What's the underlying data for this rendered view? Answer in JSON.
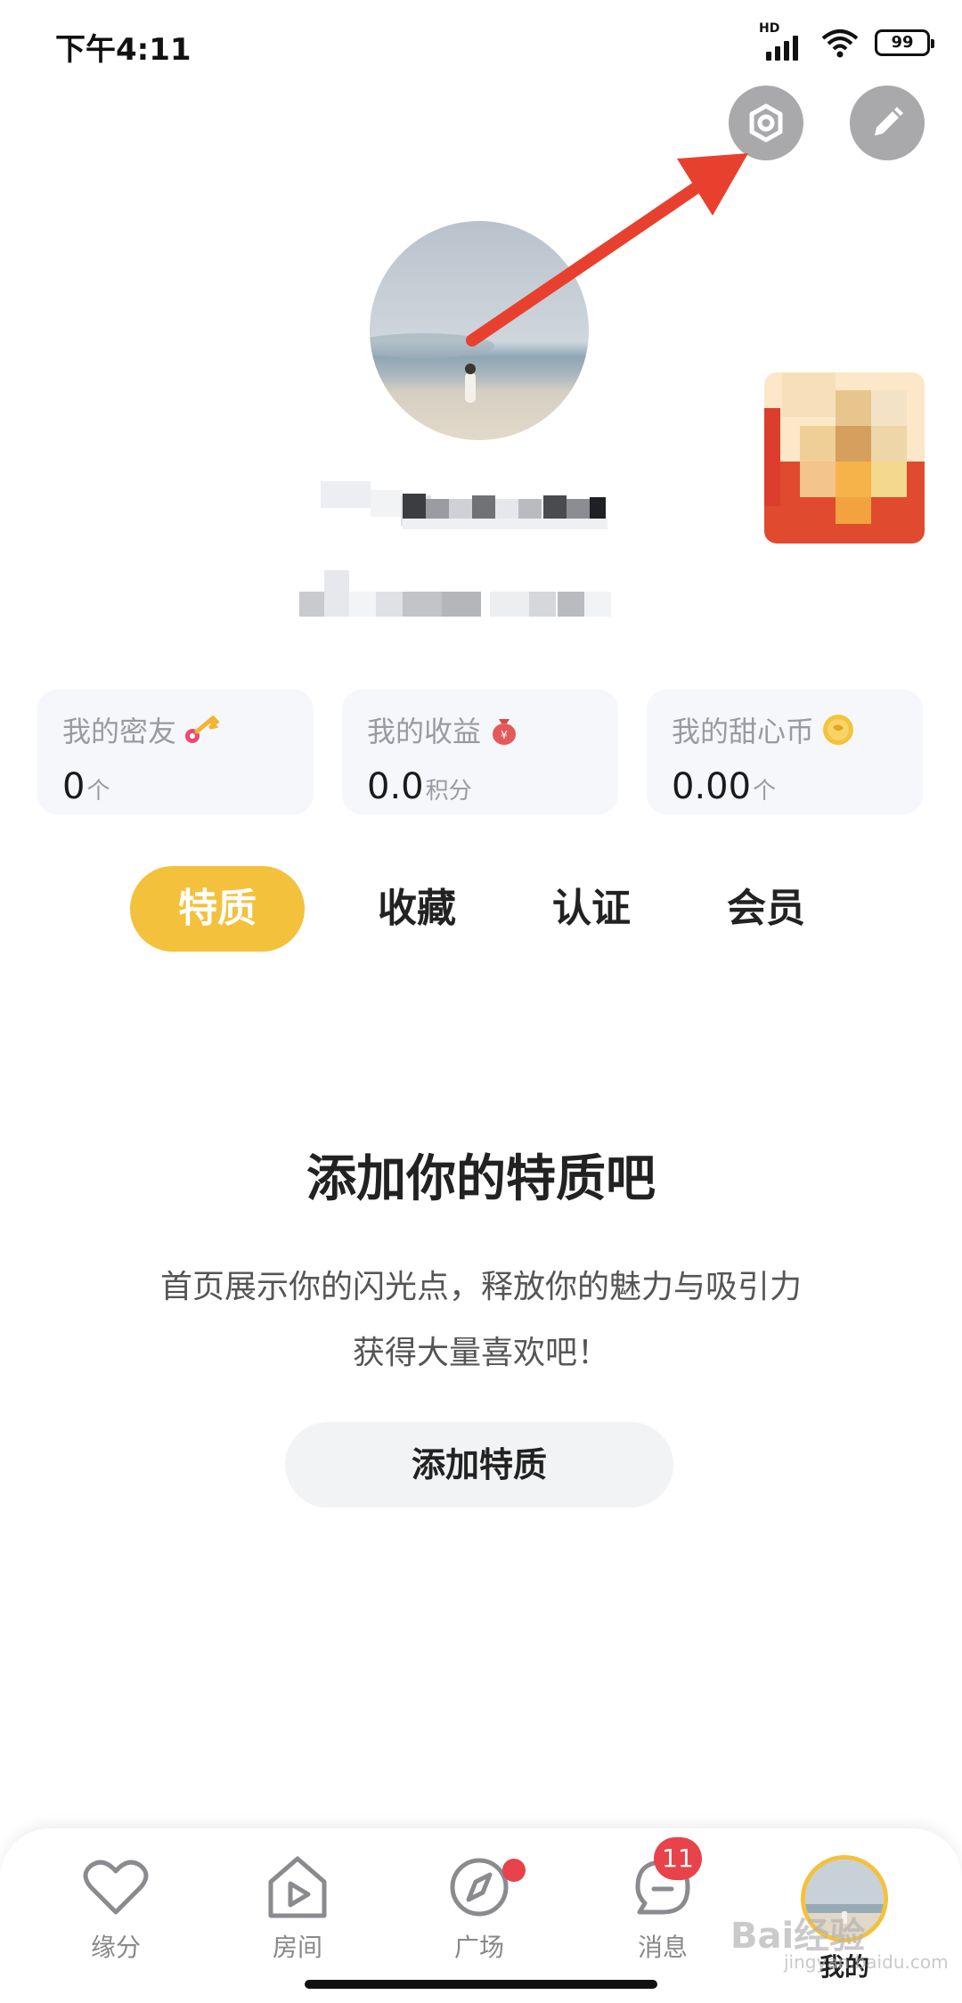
{
  "status_bar": {
    "time": "下午4:11",
    "network": "HD",
    "battery": "99"
  },
  "header": {
    "settings_icon": "gear-hex-icon",
    "edit_icon": "pencil-icon"
  },
  "stats": [
    {
      "title": "我的密友",
      "value": "0",
      "unit": "个",
      "icon": "key-icon"
    },
    {
      "title": "我的收益",
      "value": "0.0",
      "unit": "积分",
      "icon": "money-bag-icon"
    },
    {
      "title": "我的甜心币",
      "value": "0.00",
      "unit": "个",
      "icon": "coin-icon"
    }
  ],
  "tabs": [
    {
      "label": "特质",
      "active": true
    },
    {
      "label": "收藏",
      "active": false
    },
    {
      "label": "认证",
      "active": false
    },
    {
      "label": "会员",
      "active": false
    }
  ],
  "empty_state": {
    "title": "添加你的特质吧",
    "line1": "首页展示你的闪光点，释放你的魅力与吸引力",
    "line2": "获得大量喜欢吧！",
    "button": "添加特质"
  },
  "nav": [
    {
      "label": "缘分",
      "icon": "heart-icon"
    },
    {
      "label": "房间",
      "icon": "room-play-icon"
    },
    {
      "label": "广场",
      "icon": "compass-icon",
      "dot": true
    },
    {
      "label": "消息",
      "icon": "chat-icon",
      "badge": "11"
    },
    {
      "label": "我的",
      "icon": "avatar-icon",
      "active": true
    }
  ],
  "watermark": {
    "main": "Bai经验",
    "sub": "jingyan.baidu.com"
  },
  "colors": {
    "accent": "#f3c13c",
    "badge": "#e8424b",
    "annotation_arrow": "#e8402f"
  }
}
